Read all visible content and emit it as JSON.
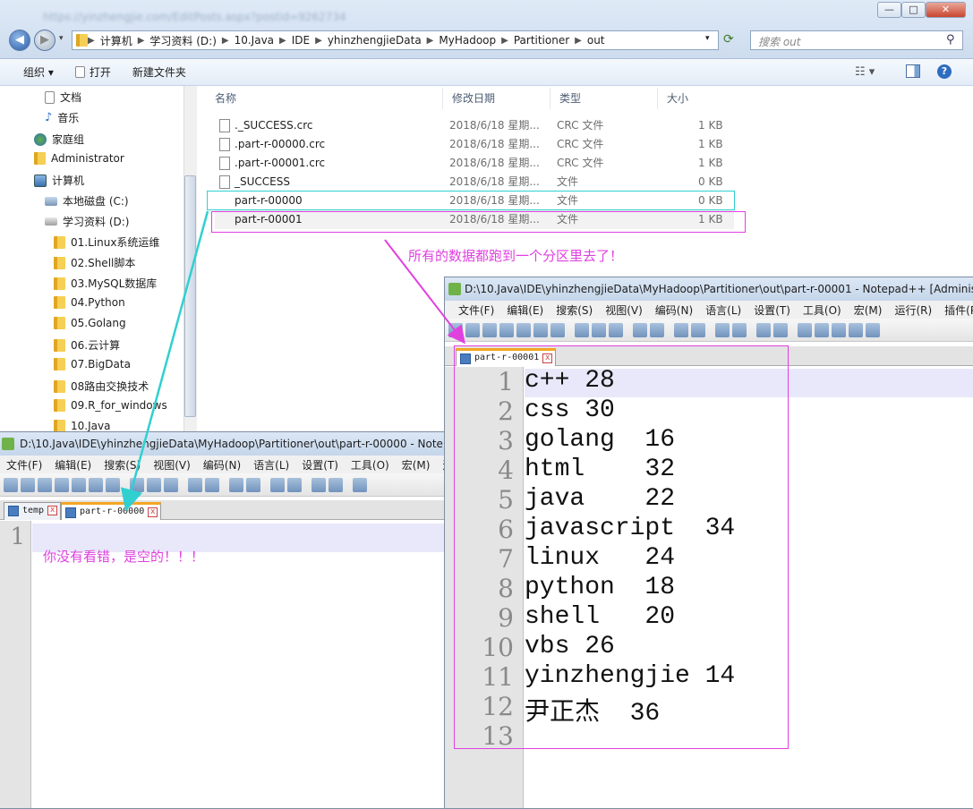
{
  "explorer": {
    "title_blurred": "https://yinzhengjie.com/EditPosts.aspx?postid=9262734",
    "window_buttons": [
      "—",
      "□",
      "✕"
    ],
    "address": {
      "segments": [
        "计算机",
        "学习资料 (D:)",
        "10.Java",
        "IDE",
        "yhinzhengjieData",
        "MyHadoop",
        "Partitioner",
        "out"
      ]
    },
    "search_placeholder": "搜索 out",
    "toolbar": {
      "organize": "组织 ▾",
      "open": "打开",
      "new_folder": "新建文件夹"
    },
    "nav_items": [
      {
        "label": "文档",
        "icon": "document-icon"
      },
      {
        "label": "音乐",
        "icon": "music-icon"
      },
      {
        "label": "家庭组",
        "icon": "homegroup-icon"
      },
      {
        "label": "Administrator",
        "icon": "user-folder-icon"
      },
      {
        "label": "计算机",
        "icon": "computer-icon"
      },
      {
        "label": "本地磁盘 (C:)",
        "icon": "drive-icon"
      },
      {
        "label": "学习资料 (D:)",
        "icon": "drive-icon"
      },
      {
        "label": "01.Linux系统运维",
        "icon": "folder-icon"
      },
      {
        "label": "02.Shell脚本",
        "icon": "folder-icon"
      },
      {
        "label": "03.MySQL数据库",
        "icon": "folder-icon"
      },
      {
        "label": "04.Python",
        "icon": "folder-icon"
      },
      {
        "label": "05.Golang",
        "icon": "folder-icon"
      },
      {
        "label": "06.云计算",
        "icon": "folder-icon"
      },
      {
        "label": "07.BigData",
        "icon": "folder-icon"
      },
      {
        "label": "08路由交换技术",
        "icon": "folder-icon"
      },
      {
        "label": "09.R_for_windows",
        "icon": "folder-icon"
      },
      {
        "label": "10.Java",
        "icon": "folder-icon"
      }
    ],
    "columns": {
      "name": "名称",
      "date": "修改日期",
      "type": "类型",
      "size": "大小"
    },
    "files": [
      {
        "name": "._SUCCESS.crc",
        "date": "2018/6/18 星期...",
        "type": "CRC 文件",
        "size": "1 KB"
      },
      {
        "name": ".part-r-00000.crc",
        "date": "2018/6/18 星期...",
        "type": "CRC 文件",
        "size": "1 KB"
      },
      {
        "name": ".part-r-00001.crc",
        "date": "2018/6/18 星期...",
        "type": "CRC 文件",
        "size": "1 KB"
      },
      {
        "name": "_SUCCESS",
        "date": "2018/6/18 星期...",
        "type": "文件",
        "size": "0 KB"
      },
      {
        "name": "part-r-00000",
        "date": "2018/6/18 星期...",
        "type": "文件",
        "size": "0 KB"
      },
      {
        "name": "part-r-00001",
        "date": "2018/6/18 星期...",
        "type": "文件",
        "size": "1 KB"
      }
    ]
  },
  "annotations": {
    "all_in_one": "所有的数据都跑到一个分区里去了！",
    "empty_note": "你没有看错，是空的！！！",
    "color_magenta": "#e040e0",
    "color_cyan": "#30d0d0"
  },
  "notepad_small": {
    "title": "D:\\10.Java\\IDE\\yhinzhengjieData\\MyHadoop\\Partitioner\\out\\part-r-00000 - Notep",
    "menu": [
      "文件(F)",
      "编辑(E)",
      "搜索(S)",
      "视图(V)",
      "编码(N)",
      "语言(L)",
      "设置(T)",
      "工具(O)",
      "宏(M)",
      "运"
    ],
    "tabs": [
      "temp",
      "part-r-00000"
    ],
    "line_numbers": [
      "1"
    ]
  },
  "notepad_main": {
    "title": "D:\\10.Java\\IDE\\yhinzhengjieData\\MyHadoop\\Partitioner\\out\\part-r-00001 - Notepad++ [Adminis",
    "menu": [
      "文件(F)",
      "编辑(E)",
      "搜索(S)",
      "视图(V)",
      "编码(N)",
      "语言(L)",
      "设置(T)",
      "工具(O)",
      "宏(M)",
      "运行(R)",
      "插件(P)"
    ],
    "tab": "part-r-00001",
    "lines": [
      {
        "n": "1",
        "text": "c++ 28"
      },
      {
        "n": "2",
        "text": "css 30"
      },
      {
        "n": "3",
        "text": "golang  16"
      },
      {
        "n": "4",
        "text": "html    32"
      },
      {
        "n": "5",
        "text": "java    22"
      },
      {
        "n": "6",
        "text": "javascript  34"
      },
      {
        "n": "7",
        "text": "linux   24"
      },
      {
        "n": "8",
        "text": "python  18"
      },
      {
        "n": "9",
        "text": "shell   20"
      },
      {
        "n": "10",
        "text": "vbs 26"
      },
      {
        "n": "11",
        "text": "yinzhengjie 14"
      },
      {
        "n": "12",
        "text": "尹正杰  36"
      },
      {
        "n": "13",
        "text": ""
      }
    ]
  }
}
